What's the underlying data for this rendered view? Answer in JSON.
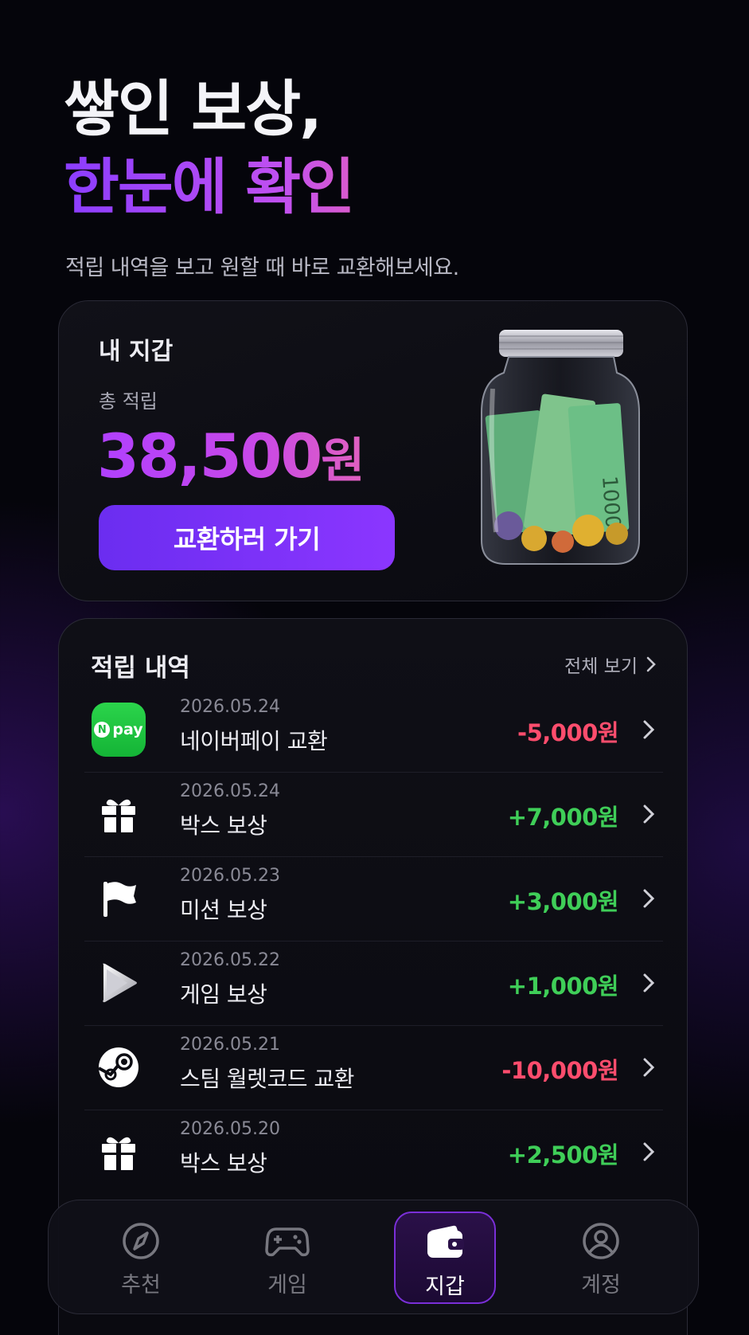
{
  "hero": {
    "line1": "쌓인 보상,",
    "line2": "한눈에 확인",
    "subtitle": "적립 내역을 보고 원할 때 바로 교환해보세요."
  },
  "wallet": {
    "title": "내 지갑",
    "total_label": "총 적립",
    "total_amount": "38,500",
    "total_unit": "원",
    "exchange_button": "교환하러 가기",
    "image": "money-jar-icon"
  },
  "history": {
    "title": "적립 내역",
    "view_all": "전체 보기",
    "items": [
      {
        "date": "2026.05.24",
        "name": "네이버페이 교환",
        "amount": "-5,000원",
        "type": "minus",
        "icon": "npay-icon",
        "icon_text": "pay",
        "icon_badge": "N"
      },
      {
        "date": "2026.05.24",
        "name": "박스 보상",
        "amount": "+7,000원",
        "type": "plus",
        "icon": "gift-icon"
      },
      {
        "date": "2026.05.23",
        "name": "미션 보상",
        "amount": "+3,000원",
        "type": "plus",
        "icon": "flag-icon"
      },
      {
        "date": "2026.05.22",
        "name": "게임 보상",
        "amount": "+1,000원",
        "type": "plus",
        "icon": "play-icon"
      },
      {
        "date": "2026.05.21",
        "name": "스팀 월렛코드 교환",
        "amount": "-10,000원",
        "type": "minus",
        "icon": "steam-icon"
      },
      {
        "date": "2026.05.20",
        "name": "박스 보상",
        "amount": "+2,500원",
        "type": "plus",
        "icon": "gift-icon"
      }
    ]
  },
  "nav": {
    "tabs": [
      {
        "label": "추천",
        "icon": "compass-icon",
        "active": false
      },
      {
        "label": "게임",
        "icon": "gamepad-icon",
        "active": false
      },
      {
        "label": "지갑",
        "icon": "wallet-icon",
        "active": true
      },
      {
        "label": "계정",
        "icon": "user-icon",
        "active": false
      }
    ]
  },
  "colors": {
    "accent": "#8b36ff",
    "plus": "#3fce58",
    "minus": "#ff4d6d",
    "background": "#05050b"
  }
}
